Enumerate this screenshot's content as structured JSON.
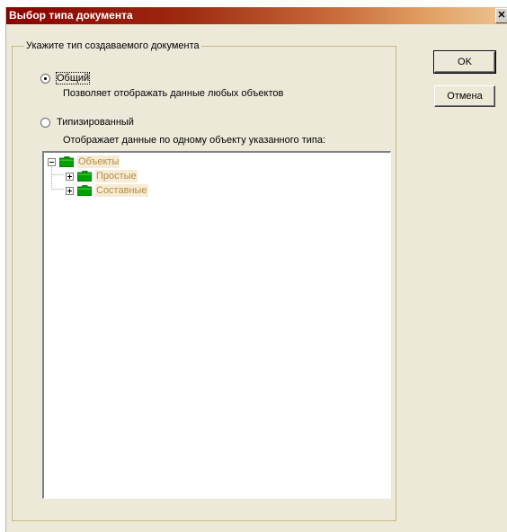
{
  "window": {
    "title": "Выбор типа документа",
    "close_glyph": "✕"
  },
  "group": {
    "legend": "Укажите тип создаваемого документа"
  },
  "options": [
    {
      "label": "Общий",
      "checked": true,
      "description": "Позволяет отображать данные любых объектов"
    },
    {
      "label": "Типизированный",
      "checked": false,
      "description": "Отображает данные по одному объекту указанного типа:"
    }
  ],
  "tree": {
    "root": {
      "label": "Объекты",
      "expanded": true,
      "icon": "folder-icon"
    },
    "children": [
      {
        "label": "Простые",
        "expanded": false,
        "icon": "folder-icon"
      },
      {
        "label": "Составные",
        "expanded": false,
        "icon": "folder-icon"
      }
    ],
    "folder_color": "#00a000"
  },
  "buttons": {
    "ok_label": "OK",
    "cancel_label": "Отмена"
  },
  "colors": {
    "title_gradient_start": "#8b0000",
    "title_gradient_end": "#ecc493",
    "dialog_background": "#ece9d8",
    "tree_label_text": "#b88a4a"
  }
}
